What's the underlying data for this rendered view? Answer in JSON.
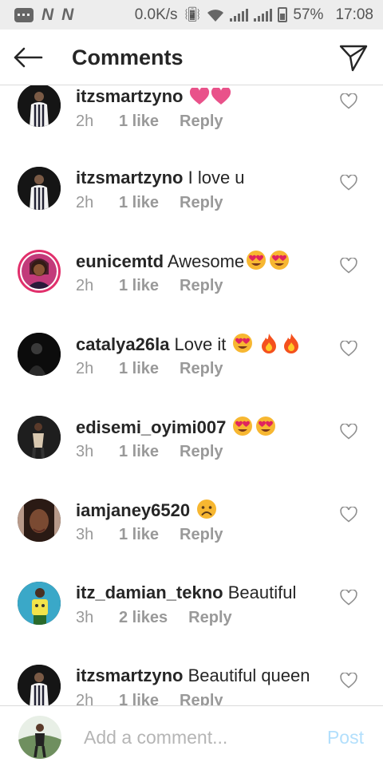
{
  "status_bar": {
    "speed": "0.0K/s",
    "battery": "57%",
    "time": "17:08",
    "carrier_marks": [
      "N",
      "N"
    ]
  },
  "header": {
    "title": "Comments"
  },
  "comments": [
    {
      "user": "itzsmartzyno",
      "text": " ",
      "emoji": [
        "heart",
        "heart"
      ],
      "time": "2h",
      "likes": "1 like",
      "reply": "Reply"
    },
    {
      "user": "itzsmartzyno",
      "text": " I love u",
      "emoji": [],
      "time": "2h",
      "likes": "1 like",
      "reply": "Reply"
    },
    {
      "user": "eunicemtd",
      "text": " Awesome",
      "emoji": [
        "heart-eyes",
        "heart-eyes"
      ],
      "time": "2h",
      "likes": "1 like",
      "reply": "Reply"
    },
    {
      "user": "catalya26la",
      "text": " Love it ",
      "emoji": [
        "heart-eyes",
        "fire",
        "fire"
      ],
      "time": "2h",
      "likes": "1 like",
      "reply": "Reply"
    },
    {
      "user": "edisemi_oyimi007",
      "text": " ",
      "emoji": [
        "heart-eyes",
        "heart-eyes"
      ],
      "time": "3h",
      "likes": "1 like",
      "reply": "Reply"
    },
    {
      "user": "iamjaney6520",
      "text": " ",
      "emoji": [
        "sad-face"
      ],
      "time": "3h",
      "likes": "1 like",
      "reply": "Reply"
    },
    {
      "user": "itz_damian_tekno",
      "text": " Beautiful",
      "emoji": [],
      "time": "3h",
      "likes": "2 likes",
      "reply": "Reply"
    },
    {
      "user": "itzsmartzyno",
      "text": " Beautiful queen",
      "emoji": [],
      "time": "2h",
      "likes": "1 like",
      "reply": "Reply"
    }
  ],
  "footer": {
    "placeholder": "Add a comment...",
    "post_label": "Post"
  },
  "colors": {
    "text": "#262626",
    "meta": "#999999",
    "post_disabled": "#b2dffc",
    "story_ring": "#e1306c"
  }
}
